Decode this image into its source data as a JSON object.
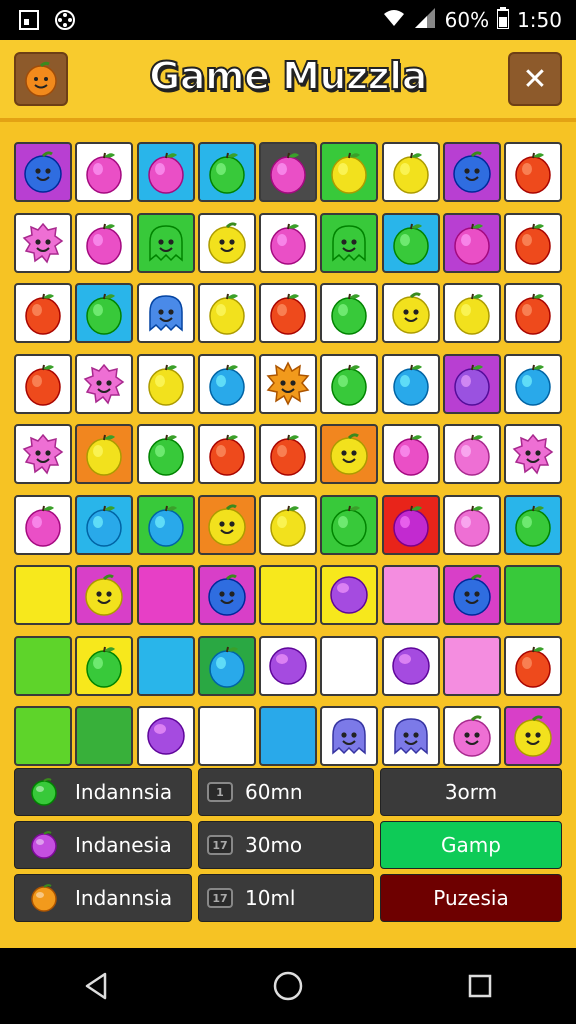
{
  "status_bar": {
    "battery": "60%",
    "time": "1:50"
  },
  "header": {
    "title": "Game Muzzla",
    "close_label": "✕"
  },
  "colors": {
    "background": "#f6c324",
    "panel_dark": "#3a3a3a",
    "button_green": "#0ecb57",
    "button_red": "#6e0000"
  },
  "board": {
    "rows": [
      [
        {
          "bg": "#b83fd2",
          "c": "#2f6de0",
          "k": "face"
        },
        {
          "bg": "#ffffff",
          "c": "#ea4fc6",
          "k": "fruit"
        },
        {
          "bg": "#29b5ea",
          "c": "#ea4fc6",
          "k": "fruit"
        },
        {
          "bg": "#29b5ea",
          "c": "#38c93a",
          "k": "fruit"
        },
        {
          "bg": "#4a4a4a",
          "c": "#ea4fc6",
          "k": "fruit"
        },
        {
          "bg": "#38c93a",
          "c": "#f2e11d",
          "k": "fruit"
        },
        {
          "bg": "#ffffff",
          "c": "#f2e11d",
          "k": "fruit"
        },
        {
          "bg": "#b83fd2",
          "c": "#2f6de0",
          "k": "face"
        },
        {
          "bg": "#ffffff",
          "c": "#ee4a1c",
          "k": "fruit"
        }
      ],
      [
        {
          "bg": "#ffffff",
          "c": "#ee6fd4",
          "k": "monster"
        },
        {
          "bg": "#ffffff",
          "c": "#ea4fc6",
          "k": "fruit"
        },
        {
          "bg": "#38c93a",
          "c": "#38c93a",
          "k": "ghost"
        },
        {
          "bg": "#ffffff",
          "c": "#f2e11d",
          "k": "face"
        },
        {
          "bg": "#ffffff",
          "c": "#ea4fc6",
          "k": "fruit"
        },
        {
          "bg": "#38c93a",
          "c": "#38c93a",
          "k": "ghost"
        },
        {
          "bg": "#29b5ea",
          "c": "#38c93a",
          "k": "fruit"
        },
        {
          "bg": "#b83fd2",
          "c": "#ea4fc6",
          "k": "fruit"
        },
        {
          "bg": "#ffffff",
          "c": "#ee4a1c",
          "k": "fruit"
        }
      ],
      [
        {
          "bg": "#ffffff",
          "c": "#ee4a1c",
          "k": "fruit"
        },
        {
          "bg": "#29b5ea",
          "c": "#38c93a",
          "k": "fruit"
        },
        {
          "bg": "#ffffff",
          "c": "#4a8ae8",
          "k": "ghost"
        },
        {
          "bg": "#ffffff",
          "c": "#f2e11d",
          "k": "fruit"
        },
        {
          "bg": "#ffffff",
          "c": "#ee4a1c",
          "k": "fruit"
        },
        {
          "bg": "#ffffff",
          "c": "#38c93a",
          "k": "fruit"
        },
        {
          "bg": "#ffffff",
          "c": "#f2e11d",
          "k": "face"
        },
        {
          "bg": "#ffffff",
          "c": "#f2e11d",
          "k": "fruit"
        },
        {
          "bg": "#ffffff",
          "c": "#ee4a1c",
          "k": "fruit"
        }
      ],
      [
        {
          "bg": "#ffffff",
          "c": "#ee4a1c",
          "k": "fruit"
        },
        {
          "bg": "#ffffff",
          "c": "#ee6fd4",
          "k": "monster"
        },
        {
          "bg": "#ffffff",
          "c": "#f2e11d",
          "k": "fruit"
        },
        {
          "bg": "#ffffff",
          "c": "#29a9ea",
          "k": "fruit"
        },
        {
          "bg": "#ffffff",
          "c": "#f29a1c",
          "k": "spiky"
        },
        {
          "bg": "#ffffff",
          "c": "#38c93a",
          "k": "fruit"
        },
        {
          "bg": "#ffffff",
          "c": "#29a9ea",
          "k": "fruit"
        },
        {
          "bg": "#b83fd2",
          "c": "#9a52e0",
          "k": "fruit"
        },
        {
          "bg": "#ffffff",
          "c": "#29a9ea",
          "k": "fruit"
        }
      ],
      [
        {
          "bg": "#ffffff",
          "c": "#ee6fd4",
          "k": "monster"
        },
        {
          "bg": "#f1861f",
          "c": "#f2e11d",
          "k": "fruit"
        },
        {
          "bg": "#ffffff",
          "c": "#38c93a",
          "k": "fruit"
        },
        {
          "bg": "#ffffff",
          "c": "#ee4a1c",
          "k": "fruit"
        },
        {
          "bg": "#ffffff",
          "c": "#ee4a1c",
          "k": "fruit"
        },
        {
          "bg": "#f1861f",
          "c": "#f2e11d",
          "k": "face"
        },
        {
          "bg": "#ffffff",
          "c": "#ea4fc6",
          "k": "fruit"
        },
        {
          "bg": "#ffffff",
          "c": "#ee6fd4",
          "k": "fruit"
        },
        {
          "bg": "#ffffff",
          "c": "#ee6fd4",
          "k": "monster"
        }
      ],
      [
        {
          "bg": "#ffffff",
          "c": "#ea4fc6",
          "k": "fruit"
        },
        {
          "bg": "#29b5ea",
          "c": "#29a9ea",
          "k": "fruit"
        },
        {
          "bg": "#38c93a",
          "c": "#29a9ea",
          "k": "fruit"
        },
        {
          "bg": "#f1861f",
          "c": "#f2e11d",
          "k": "face"
        },
        {
          "bg": "#ffffff",
          "c": "#f2e11d",
          "k": "fruit"
        },
        {
          "bg": "#38c93a",
          "c": "#38c93a",
          "k": "fruit"
        },
        {
          "bg": "#e8241a",
          "c": "#c22ad0",
          "k": "fruit"
        },
        {
          "bg": "#ffffff",
          "c": "#ee6fd4",
          "k": "fruit"
        },
        {
          "bg": "#29b5ea",
          "c": "#38c93a",
          "k": "fruit"
        }
      ],
      [
        {
          "bg": "#f7e81c",
          "c": "",
          "k": "empty"
        },
        {
          "bg": "#d83fc8",
          "c": "#f2e11d",
          "k": "face"
        },
        {
          "bg": "#e73fc6",
          "c": "",
          "k": "empty"
        },
        {
          "bg": "#d83fc8",
          "c": "#2f6de0",
          "k": "face"
        },
        {
          "bg": "#f7e81c",
          "c": "",
          "k": "empty"
        },
        {
          "bg": "#f7e81c",
          "c": "#a54be0",
          "k": "ball"
        },
        {
          "bg": "#f48de0",
          "c": "",
          "k": "empty"
        },
        {
          "bg": "#d83fc8",
          "c": "#2f6de0",
          "k": "face"
        },
        {
          "bg": "#38c93a",
          "c": "",
          "k": "empty"
        }
      ],
      [
        {
          "bg": "#5ed42a",
          "c": "",
          "k": "empty"
        },
        {
          "bg": "#f7e81c",
          "c": "#38c93a",
          "k": "fruit"
        },
        {
          "bg": "#29b5ea",
          "c": "",
          "k": "empty"
        },
        {
          "bg": "#2aa843",
          "c": "#29a9ea",
          "k": "fruit"
        },
        {
          "bg": "#ffffff",
          "c": "#a54be0",
          "k": "ball"
        },
        {
          "bg": "#ffffff",
          "c": "",
          "k": "empty"
        },
        {
          "bg": "#ffffff",
          "c": "#a54be0",
          "k": "ball"
        },
        {
          "bg": "#f48de0",
          "c": "",
          "k": "empty"
        },
        {
          "bg": "#ffffff",
          "c": "#ee4a1c",
          "k": "fruit"
        }
      ],
      [
        {
          "bg": "#5ed42a",
          "c": "",
          "k": "empty"
        },
        {
          "bg": "#38b03a",
          "c": "",
          "k": "empty"
        },
        {
          "bg": "#ffffff",
          "c": "#a54be0",
          "k": "ball"
        },
        {
          "bg": "#ffffff",
          "c": "",
          "k": "empty"
        },
        {
          "bg": "#29a9ea",
          "c": "",
          "k": "empty"
        },
        {
          "bg": "#ffffff",
          "c": "#7c7ae8",
          "k": "ghost"
        },
        {
          "bg": "#ffffff",
          "c": "#7c7ae8",
          "k": "ghost"
        },
        {
          "bg": "#ffffff",
          "c": "#ee6fd4",
          "k": "face"
        },
        {
          "bg": "#d83fc8",
          "c": "#f2e11d",
          "k": "face"
        }
      ]
    ]
  },
  "panel": {
    "rows": [
      {
        "gem_color": "#38c93a",
        "name": "Indannsia",
        "icon_text": "1",
        "value": "60mn",
        "action": "3orm",
        "action_bg": "#3a3a3a"
      },
      {
        "gem_color": "#c44fe0",
        "name": "Indanesia",
        "icon_text": "17",
        "value": "30mo",
        "action": "Gamp",
        "action_bg": "#0ecb57"
      },
      {
        "gem_color": "#f29a1c",
        "name": "Indannsia",
        "icon_text": "17",
        "value": "10ml",
        "action": "Puzesia",
        "action_bg": "#6e0000"
      }
    ]
  },
  "nav": {
    "back_icon": "back-icon",
    "home_icon": "home-icon",
    "recents_icon": "recents-icon"
  }
}
